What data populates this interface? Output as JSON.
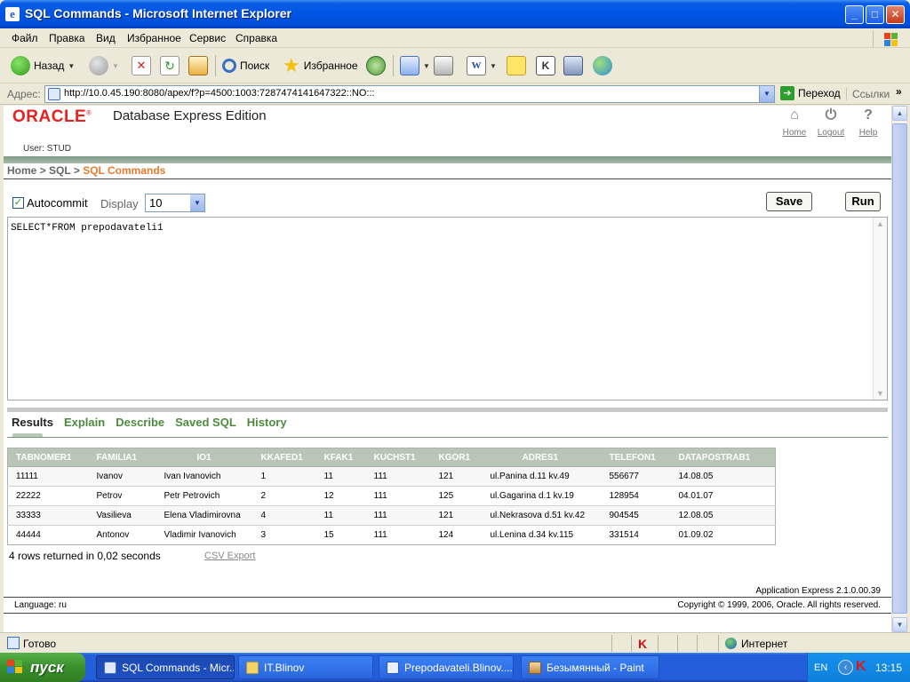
{
  "window": {
    "title": "SQL Commands - Microsoft Internet Explorer"
  },
  "menu": {
    "items": [
      "Файл",
      "Правка",
      "Вид",
      "Избранное",
      "Сервис",
      "Справка"
    ]
  },
  "toolbar": {
    "back_label": "Назад",
    "search_label": "Поиск",
    "favorites_label": "Избранное"
  },
  "address": {
    "label": "Адрес:",
    "url": "http://10.0.45.190:8080/apex/f?p=4500:1003:7287474141647322::NO:::",
    "go_label": "Переход",
    "links_label": "Ссылки"
  },
  "oracle": {
    "logo": "ORACLE",
    "edition": "Database Express Edition",
    "nav": {
      "home": "Home",
      "logout": "Logout",
      "help": "Help"
    },
    "user_label": "User:",
    "user_name": "STUD"
  },
  "breadcrumb": {
    "home": "Home",
    "sep1": ">",
    "sql": "SQL",
    "sep2": ">",
    "current": "SQL Commands"
  },
  "sql_commands": {
    "autocommit_label": "Autocommit",
    "autocommit_checked": true,
    "display_label": "Display",
    "display_value": "10",
    "save_label": "Save",
    "run_label": "Run",
    "query": "SELECT*FROM prepodavateli1"
  },
  "results": {
    "tabs": [
      "Results",
      "Explain",
      "Describe",
      "Saved SQL",
      "History"
    ],
    "active_tab": "Results",
    "columns": [
      "TABNOMER1",
      "FAMILIA1",
      "IO1",
      "KKAFED1",
      "KFAK1",
      "KUCHST1",
      "KGOR1",
      "ADRES1",
      "TELEFON1",
      "DATAPOSTRAB1"
    ],
    "rows": [
      [
        "11111",
        "Ivanov",
        "Ivan Ivanovich",
        "1",
        "11",
        "111",
        "121",
        "ul.Panina d.11 kv.49",
        "556677",
        "14.08.05"
      ],
      [
        "22222",
        "Petrov",
        "Petr Petrovich",
        "2",
        "12",
        "111",
        "125",
        "ul.Gagarina d.1 kv.19",
        "128954",
        "04.01.07"
      ],
      [
        "33333",
        "Vasilieva",
        "Elena Vladimirovna",
        "4",
        "11",
        "111",
        "121",
        "ul.Nekrasova d.51 kv.42",
        "904545",
        "12.08.05"
      ],
      [
        "44444",
        "Antonov",
        "Vladimir Ivanovich",
        "3",
        "15",
        "111",
        "124",
        "ul.Lenina d.34 kv.115",
        "331514",
        "01.09.02"
      ]
    ],
    "rows_message": "4 rows returned in 0,02 seconds",
    "csv_export": "CSV Export"
  },
  "footer": {
    "app_version": "Application Express 2.1.0.00.39",
    "language": "Language: ru",
    "copyright": "Copyright © 1999, 2006, Oracle. All rights reserved."
  },
  "statusbar": {
    "status": "Готово",
    "zone": "Интернет"
  },
  "taskbar": {
    "start_label": "пуск",
    "tasks": [
      "SQL Commands - Micr...",
      "IT.Blinov",
      "Prepodavateli.Blinov....",
      "Безымянный - Paint"
    ],
    "lang": "EN",
    "clock": "13:15"
  },
  "colors": {
    "oracle_red": "#e8201f",
    "breadcrumb_current": "#e87a2c",
    "tab_green": "#4e8a3e",
    "table_header": "#b9c6b7",
    "xp_blue": "#0054e3",
    "start_green": "#3a8f2c"
  }
}
